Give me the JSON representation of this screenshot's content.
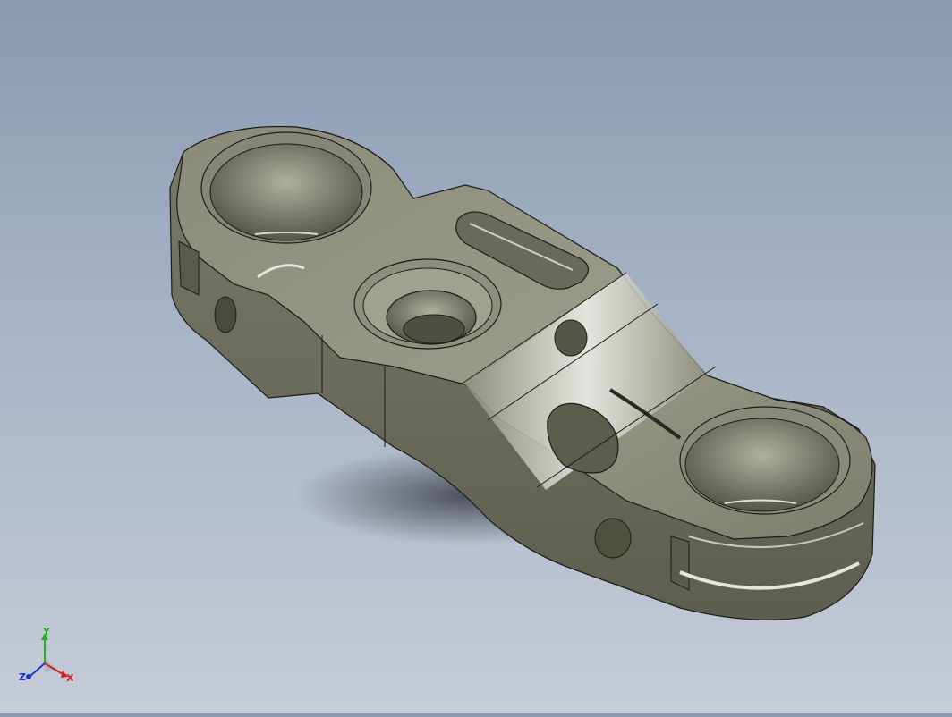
{
  "viewport": {
    "background_top": "#8a9ab2",
    "background_bottom": "#c6ccd8",
    "part_color": "#7d7d6c",
    "edge_color": "#1b1b18"
  },
  "triad": {
    "x_label": "X",
    "y_label": "Y",
    "z_label": "Z",
    "x_color": "#d42020",
    "y_color": "#22b022",
    "z_color": "#2030d0"
  }
}
